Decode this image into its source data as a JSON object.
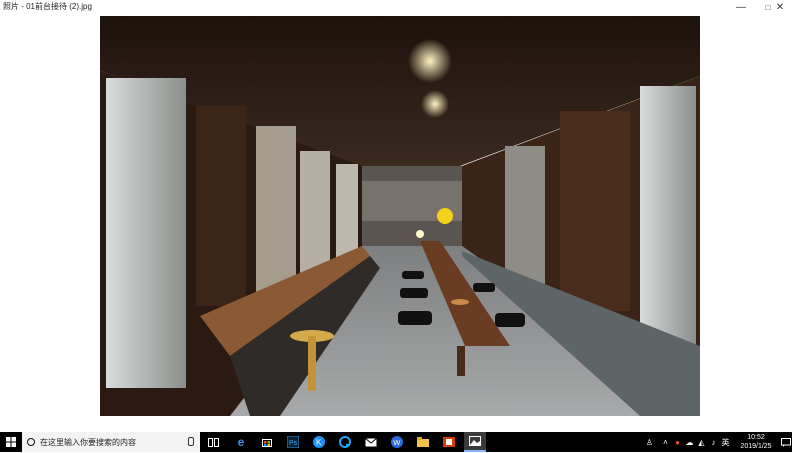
{
  "window": {
    "title": "照片 - 01前台接待 (2).jpg",
    "controls": {
      "minimize": "—",
      "maximize": "□",
      "close": "✕"
    }
  },
  "taskbar": {
    "search_placeholder": "在这里输入你要搜索的内容",
    "apps": [
      "task-view",
      "edge",
      "store",
      "photoshop",
      "app-k",
      "app-q",
      "mail",
      "app-w",
      "file-explorer",
      "office",
      "photos"
    ],
    "tray": {
      "language": "英"
    },
    "clock": {
      "time": "10:52",
      "date": "2019/1/25"
    }
  },
  "colors": {
    "taskbar": "#000000",
    "accent": "#0078d7"
  }
}
